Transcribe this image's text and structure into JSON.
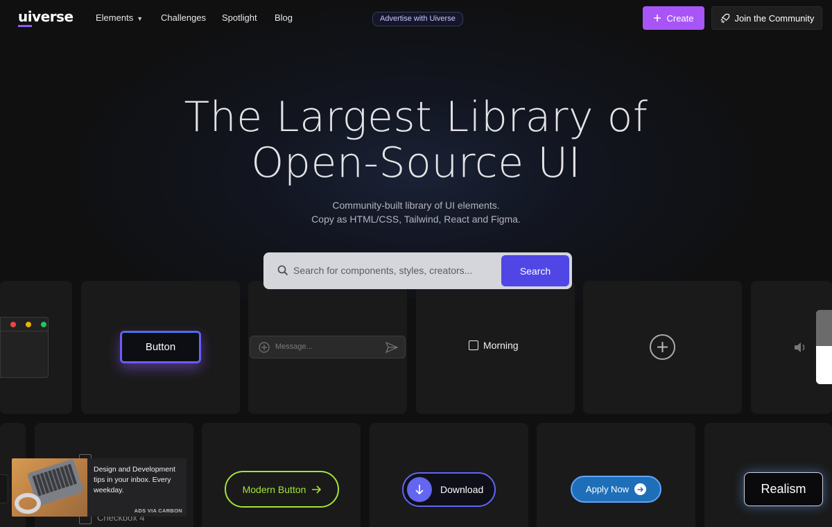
{
  "nav": {
    "logo_ui": "ui",
    "logo_rest": "verse",
    "items": [
      "Elements",
      "Challenges",
      "Spotlight",
      "Blog"
    ],
    "advertise": "Advertise with Uiverse",
    "create": "Create",
    "join": "Join the Community"
  },
  "hero": {
    "title_line1": "The Largest Library of",
    "title_line2": "Open-Source UI",
    "sub_line1": "Community-built library of UI elements.",
    "sub_line2": "Copy as HTML/CSS, Tailwind, React and Figma."
  },
  "search": {
    "placeholder": "Search for components, styles, creators...",
    "button": "Search"
  },
  "cards": {
    "neon_button": "Button",
    "message_placeholder": "Message...",
    "checkbox_label": "Morning",
    "modern_button": "Modern Button",
    "download": "Download",
    "apply": "Apply Now",
    "realism": "Realism",
    "checkbox_bottom": "Checkbox 4"
  },
  "ad": {
    "text": "Design and Development tips in your inbox. Every weekday.",
    "via": "ADS VIA CARBON"
  },
  "colors": {
    "accent_purple": "#a855f7",
    "search_blue": "#4f46e5",
    "lime": "#a3e635"
  }
}
